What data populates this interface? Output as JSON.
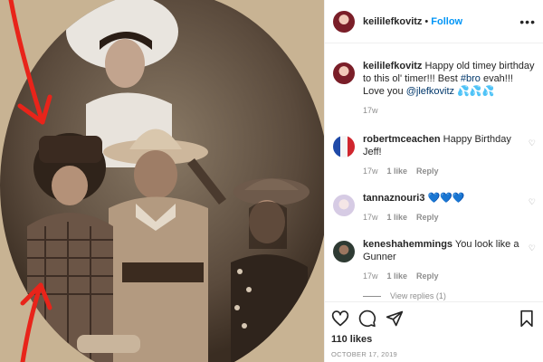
{
  "post": {
    "username": "keililefkovitz",
    "follow_label": "Follow",
    "more_label": "•••",
    "caption": {
      "username": "keililefkovitz",
      "text_before": "Happy old timey birthday to this ol' timer!!! Best ",
      "hashtag": "#bro",
      "text_middle": " evah!!! Love you ",
      "mention": "@jlefkovitz",
      "emoji": "💦💦💦",
      "time": "17w"
    }
  },
  "comments": [
    {
      "username": "robertmceachen",
      "text": "Happy Birthday Jeff!",
      "time": "17w",
      "likes": "1 like",
      "reply": "Reply"
    },
    {
      "username": "tannaznouri3",
      "text": "💙💙💙",
      "time": "17w",
      "likes": "1 like",
      "reply": "Reply"
    },
    {
      "username": "keneshahemmings",
      "text": "You look like a Gunner",
      "time": "17w",
      "likes": "1 like",
      "reply": "Reply"
    }
  ],
  "view_replies": "View replies (1)",
  "footer": {
    "likes": "110 likes",
    "date": "OCTOBER 17, 2019"
  },
  "colors": {
    "accent": "#0095f6",
    "arrow": "#e8241a",
    "sepia_dark": "#3a2d22",
    "sepia_light": "#c9b79a"
  },
  "icons": [
    "heart-icon",
    "comment-icon",
    "share-icon",
    "bookmark-icon",
    "more-options-icon"
  ]
}
